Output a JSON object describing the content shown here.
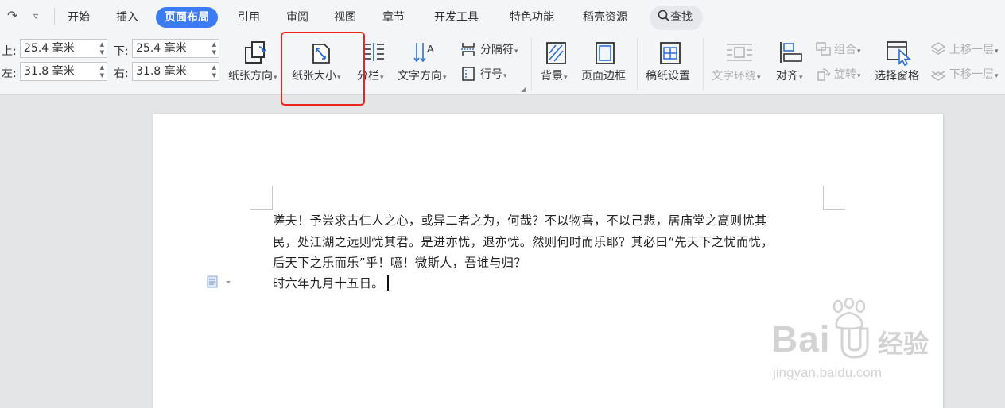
{
  "tabs": [
    "开始",
    "插入",
    "页面布局",
    "引用",
    "审阅",
    "视图",
    "章节",
    "开发工具",
    "特色功能",
    "稻壳资源"
  ],
  "active_tab": "页面布局",
  "find": {
    "label": "查找"
  },
  "margins": {
    "top": {
      "label": "上:",
      "value": "25.4 毫米"
    },
    "bottom": {
      "label": "下:",
      "value": "25.4 毫米"
    },
    "left": {
      "label": "左:",
      "value": "31.8 毫米"
    },
    "right": {
      "label": "右:",
      "value": "31.8 毫米"
    }
  },
  "ribbon": {
    "orientation": "纸张方向",
    "size": "纸张大小",
    "columns": "分栏",
    "text_direction": "文字方向",
    "breaks": "分隔符",
    "line_numbers": "行号",
    "background": "背景",
    "page_border": "页面边框",
    "draft_paper": "稿纸设置",
    "text_wrap": "文字环绕",
    "align": "对齐",
    "group": "组合",
    "rotate": "旋转",
    "selection_pane": "选择窗格",
    "bring_forward": "上移一层",
    "send_backward": "下移一层"
  },
  "document": {
    "lines": [
      "嗟夫！予尝求古仁人之心，或异二者之为，何哉？不以物喜，不以己悲，居庙堂之高则忧其",
      "民，处江湖之远则忧其君。是进亦忧，退亦忧。然则何时而乐耶？其必曰“先天下之忧而忧，",
      "后天下之乐而乐”乎！噫！微斯人，吾谁与归？",
      "时六年九月十五日。"
    ]
  },
  "watermark": {
    "brand": "Bai",
    "brand_cn": "经验",
    "url": "jingyan.baidu.com"
  },
  "colors": {
    "accent": "#3b7cf4",
    "highlight_box": "#e8261f",
    "icon_blue": "#2d6fd8"
  }
}
